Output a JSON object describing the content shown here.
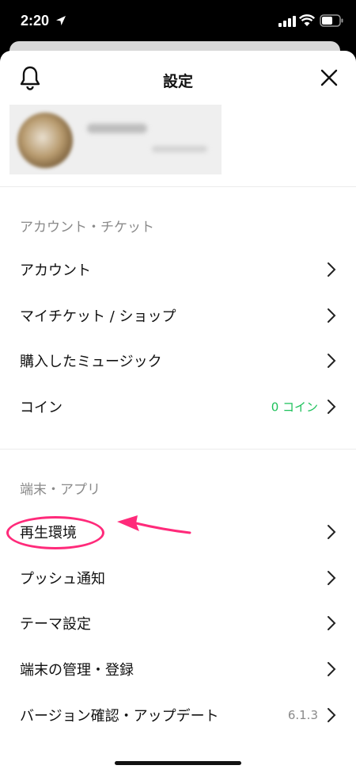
{
  "status_bar": {
    "time": "2:20",
    "icons": [
      "location-arrow-icon",
      "signal-icon",
      "wifi-icon",
      "battery-icon"
    ]
  },
  "header": {
    "title": "設定",
    "left_icon": "bell-icon",
    "right_icon": "close-icon"
  },
  "sections": [
    {
      "title": "アカウント・チケット",
      "items": [
        {
          "label": "アカウント"
        },
        {
          "label": "マイチケット / ショップ"
        },
        {
          "label": "購入したミュージック"
        },
        {
          "label": "コイン",
          "value": "0 コイン"
        }
      ]
    },
    {
      "title": "端末・アプリ",
      "items": [
        {
          "label": "再生環境"
        },
        {
          "label": "プッシュ通知"
        },
        {
          "label": "テーマ設定"
        },
        {
          "label": "端末の管理・登録"
        },
        {
          "label": "バージョン確認・アップデート",
          "value": "6.1.3"
        }
      ]
    }
  ],
  "colors": {
    "accent_green": "#1ec15b",
    "annotation_pink": "#ff2a7a",
    "section_gray": "#8a8a8a"
  }
}
